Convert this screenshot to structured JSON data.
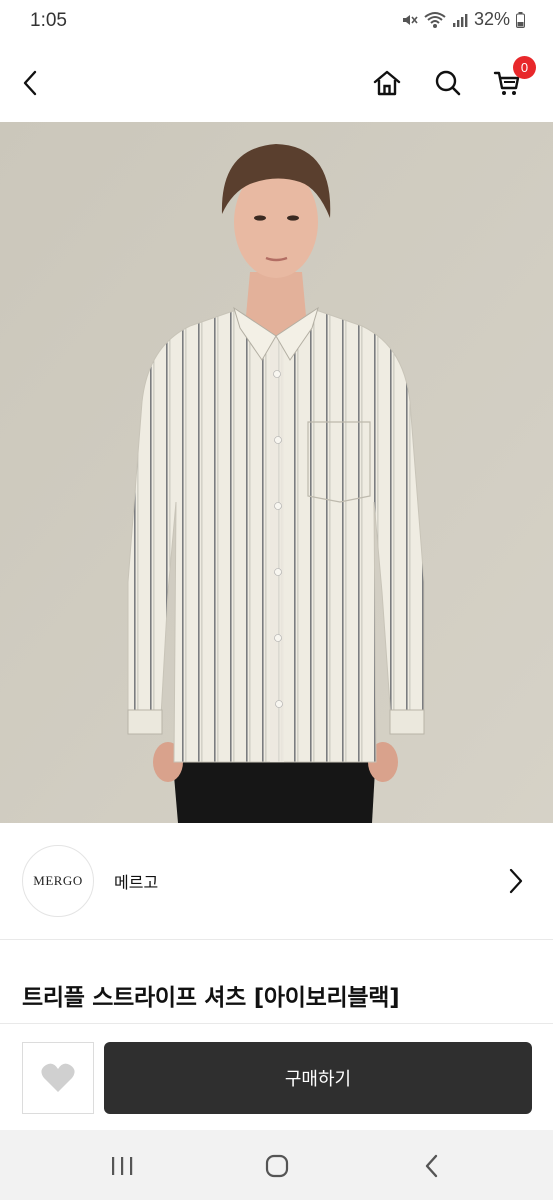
{
  "status_bar": {
    "time": "1:05",
    "battery": "32%"
  },
  "header": {
    "cart_count": "0"
  },
  "brand": {
    "logo_text": "MERGO",
    "name": "메르고"
  },
  "product": {
    "title": "트리플 스트라이프 셔츠 [아이보리블랙]"
  },
  "actions": {
    "buy_label": "구매하기"
  },
  "colors": {
    "badge": "#e8282b",
    "buy_button": "#2f2f2f",
    "image_background": "#cfcbc0"
  }
}
